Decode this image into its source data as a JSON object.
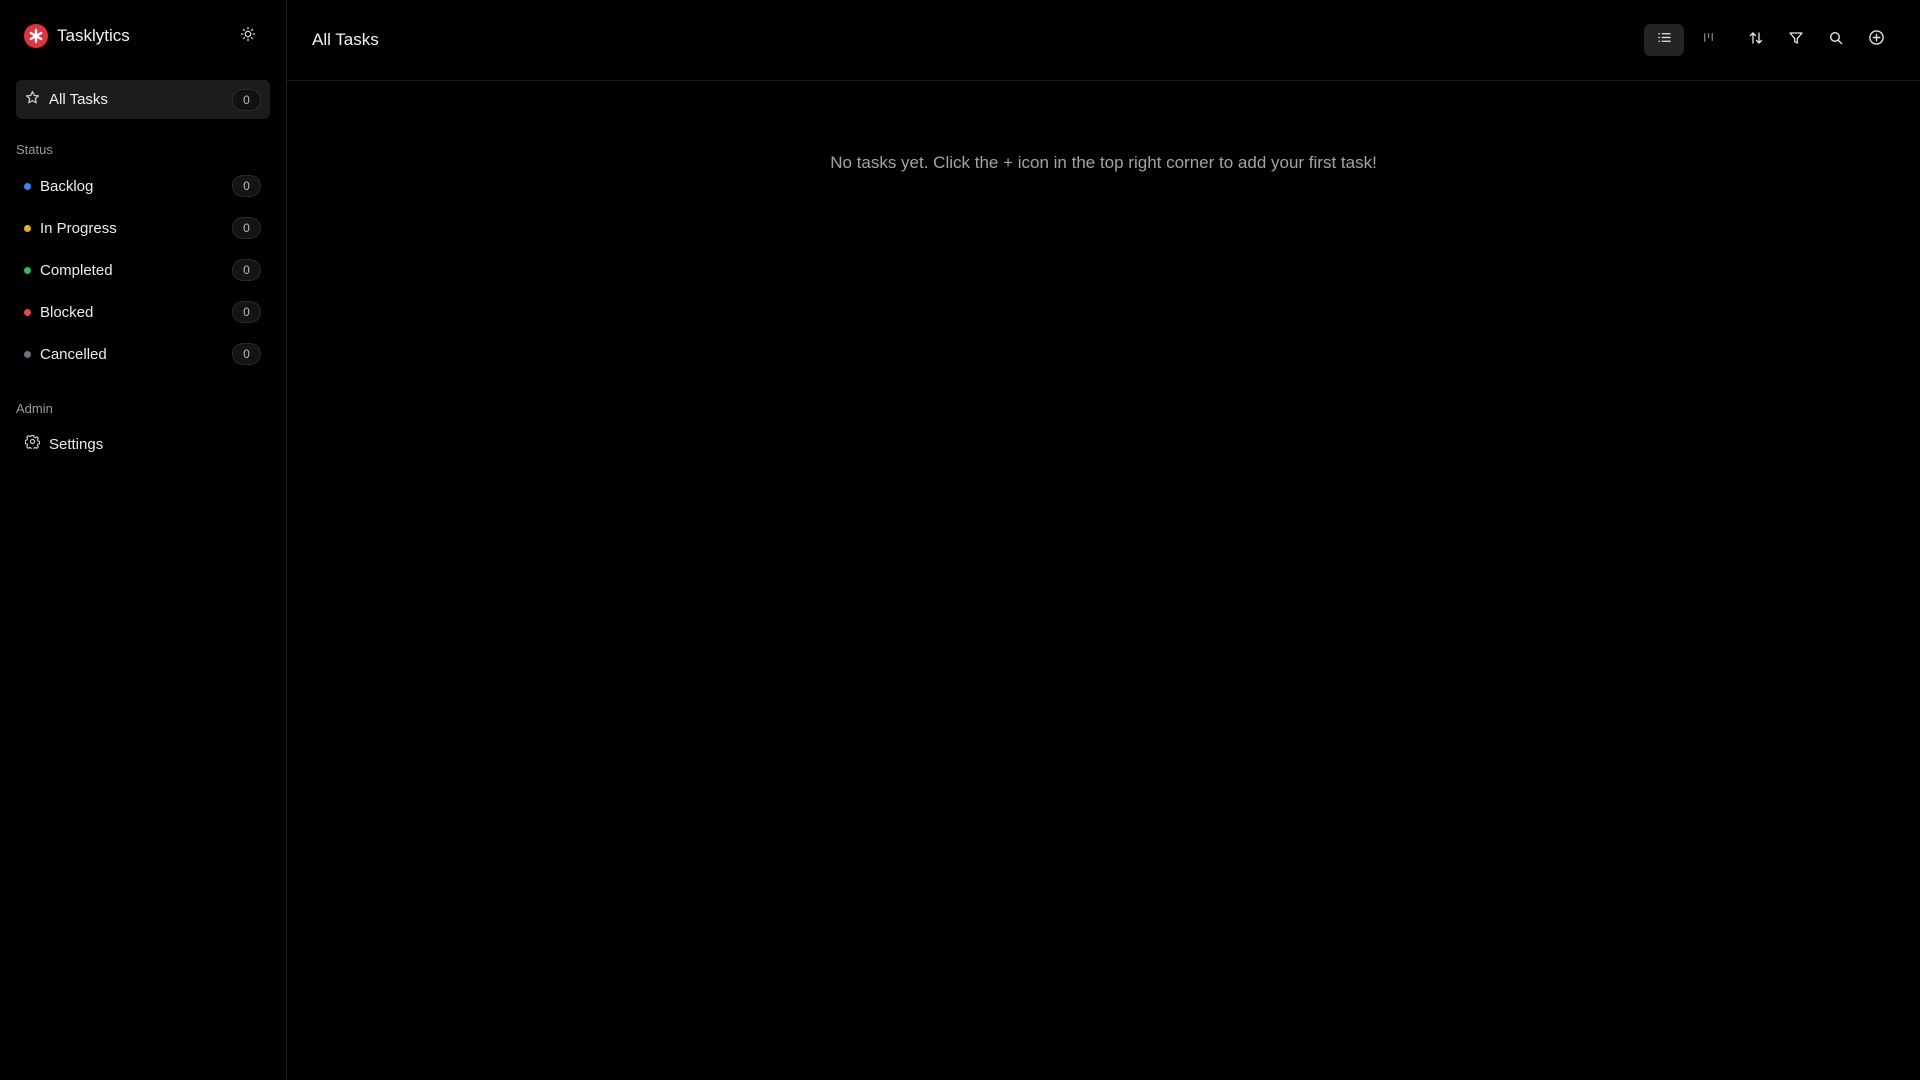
{
  "app": {
    "name": "Tasklytics",
    "brand_color": "#e5323e"
  },
  "sidebar": {
    "all_tasks": {
      "label": "All Tasks",
      "count": "0",
      "icon": "star-icon"
    },
    "status_heading": "Status",
    "statuses": [
      {
        "label": "Backlog",
        "count": "0",
        "color": "#3b82f6"
      },
      {
        "label": "In Progress",
        "count": "0",
        "color": "#eab308"
      },
      {
        "label": "Completed",
        "count": "0",
        "color": "#22c55e"
      },
      {
        "label": "Blocked",
        "count": "0",
        "color": "#ef4444"
      },
      {
        "label": "Cancelled",
        "count": "0",
        "color": "#6b7280"
      }
    ],
    "admin_heading": "Admin",
    "settings": {
      "label": "Settings",
      "icon": "gear-icon"
    },
    "theme_toggle_icon": "sun-icon"
  },
  "header": {
    "title": "All Tasks",
    "toolbar": [
      {
        "name": "list-view",
        "icon": "list-icon",
        "active": true
      },
      {
        "name": "board-view",
        "icon": "kanban-icon",
        "active": false
      },
      {
        "name": "sort",
        "icon": "sort-arrows-icon",
        "active": false
      },
      {
        "name": "filter",
        "icon": "filter-icon",
        "active": false
      },
      {
        "name": "search",
        "icon": "search-icon",
        "active": false
      },
      {
        "name": "add-task",
        "icon": "plus-circle-icon",
        "active": false
      }
    ]
  },
  "main": {
    "empty_message": "No tasks yet. Click the + icon in the top right corner to add your first task!"
  }
}
